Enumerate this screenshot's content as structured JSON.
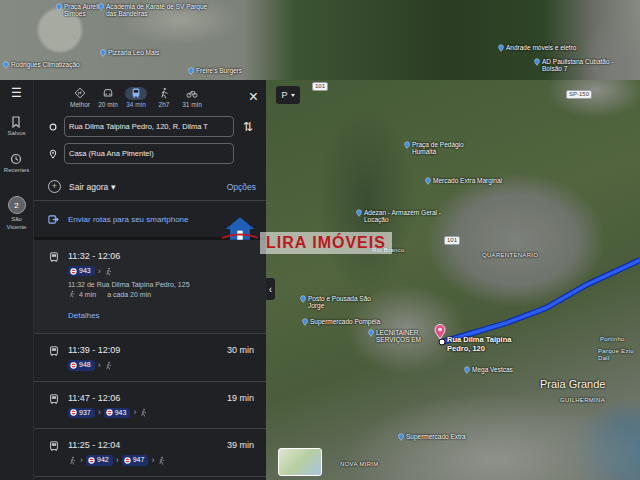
{
  "rail": {
    "menu": "☰",
    "items": [
      {
        "label": "Salvos",
        "kind": "saved"
      },
      {
        "label": "Recentes",
        "kind": "recent"
      }
    ],
    "account": {
      "badge": "2",
      "label": "São Vicente"
    }
  },
  "modes": [
    {
      "label": "Melhor",
      "kind": "best",
      "selected": false
    },
    {
      "label": "20 min",
      "kind": "car",
      "selected": false
    },
    {
      "label": "34 min",
      "kind": "transit",
      "selected": true
    },
    {
      "label": "2h7",
      "kind": "walk",
      "selected": false
    },
    {
      "label": "31 min",
      "kind": "bike",
      "selected": false
    }
  ],
  "close": "×",
  "origin": "Rua Dilma Taipina Pedro, 120, R. Dilma T",
  "destination": "Casa (Rua Ana Pimentel)",
  "swap": "⇅",
  "depart": "Sair agora",
  "depart_caret": "▾",
  "add": "+",
  "options": "Opções",
  "send": "Enviar rotas para seu smartphone",
  "separator": "›",
  "routes": [
    {
      "times": "11:32 - 12:06",
      "selected": true,
      "legs": [
        {
          "kind": "bus",
          "line": "943"
        },
        {
          "kind": "walk"
        }
      ],
      "stop": "11:32 de Rua Dilma Taipina Pedro, 125",
      "walk": "4 min",
      "frequency": "a cada 20 min",
      "link": "Detalhes"
    },
    {
      "times": "11:39 - 12:09",
      "duration": "30 min",
      "selected": false,
      "legs": [
        {
          "kind": "bus",
          "line": "948"
        },
        {
          "kind": "walk"
        }
      ]
    },
    {
      "times": "11:47 - 12:06",
      "duration": "19 min",
      "selected": false,
      "legs": [
        {
          "kind": "bus",
          "line": "937"
        },
        {
          "kind": "bus",
          "line": "943"
        },
        {
          "kind": "walk"
        }
      ]
    },
    {
      "times": "11:25 - 12:04",
      "duration": "39 min",
      "selected": false,
      "legs": [
        {
          "kind": "walk"
        },
        {
          "kind": "bus",
          "line": "942"
        },
        {
          "kind": "bus",
          "line": "947"
        },
        {
          "kind": "walk"
        }
      ]
    }
  ],
  "map": {
    "layer_button": "P",
    "collapse": "‹",
    "pin_label": "Rua Dilma Taipina Pedro, 120",
    "labels": [
      {
        "text": "Praça Aurelio Simoes",
        "kind": "place"
      },
      {
        "text": "Academia de Karatê de SV Parque das Bandeiras",
        "kind": "place"
      },
      {
        "text": "Pizzaria Leo Mais",
        "kind": "place"
      },
      {
        "text": "Freire's Burgers",
        "kind": "place"
      },
      {
        "text": "Rodrigues Climatização",
        "kind": "place"
      },
      {
        "text": "Andrade móveis e eletro",
        "kind": "place"
      },
      {
        "text": "AD Paulistana Cubatão - Bolsão 7",
        "kind": "place"
      },
      {
        "text": "Praça de Pedágio Humaitá",
        "kind": "place"
      },
      {
        "text": "Mercado Extra Marginal",
        "kind": "place"
      },
      {
        "text": "Adezan - Armazém Geral - Locação",
        "kind": "place"
      },
      {
        "text": "Posto e Pousada São Jorge",
        "kind": "place"
      },
      {
        "text": "Supermercado Pompéia",
        "kind": "place"
      },
      {
        "text": "LECNITAINER SERVIÇOS EM",
        "kind": "place"
      },
      {
        "text": "Mega Vestcas",
        "kind": "place"
      },
      {
        "text": "Praia Grande",
        "kind": "city"
      },
      {
        "text": "GUILHERMINA",
        "kind": "area"
      },
      {
        "text": "Supermercado Extra",
        "kind": "place"
      },
      {
        "text": "NOVA MIRIM",
        "kind": "area"
      },
      {
        "text": "QUARENTENARIO",
        "kind": "area"
      },
      {
        "text": "Rio Branco",
        "kind": "area"
      },
      {
        "text": "Portinho",
        "kind": "area"
      },
      {
        "text": "Parque Ezio Dall",
        "kind": "area"
      },
      {
        "text": "101",
        "kind": "road"
      },
      {
        "text": "101",
        "kind": "road"
      },
      {
        "text": "SP-150",
        "kind": "road"
      }
    ]
  },
  "watermark": "LIRA IMÓVEIS"
}
